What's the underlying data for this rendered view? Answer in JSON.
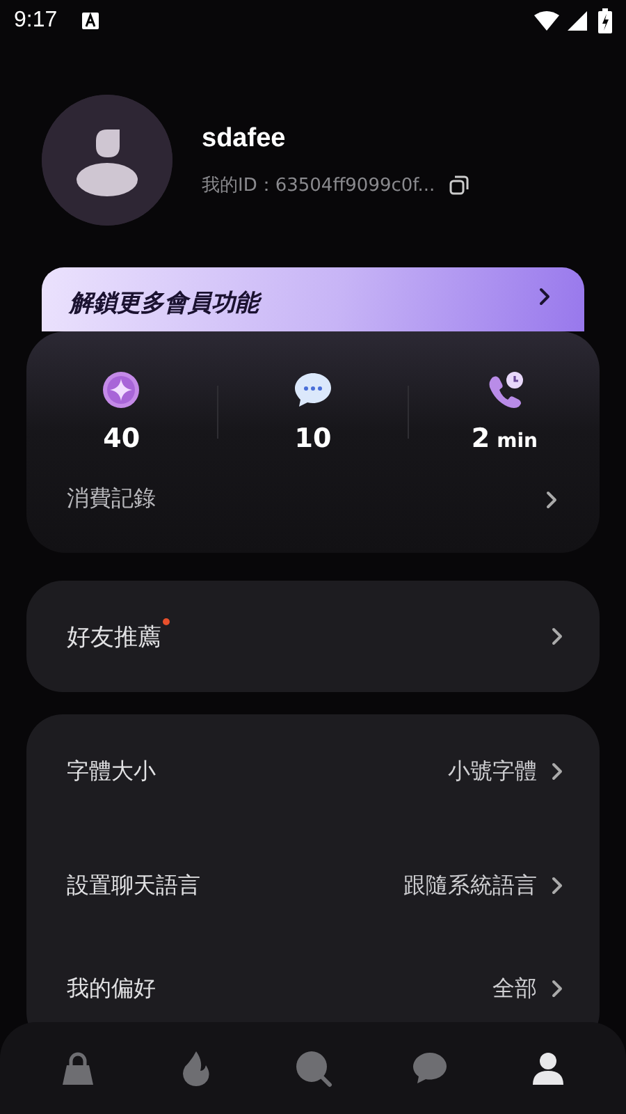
{
  "status_bar": {
    "time": "9:17"
  },
  "profile": {
    "name": "sdafee",
    "id_text": "我的ID：63504ff9099c0f..."
  },
  "vip_banner": {
    "title": "解鎖更多會員功能"
  },
  "stats": [
    {
      "kind": "coin",
      "value": "40"
    },
    {
      "kind": "chat",
      "value": "10"
    },
    {
      "kind": "call",
      "value": "2",
      "unit": "min"
    }
  ],
  "spending": {
    "label": "消費記錄"
  },
  "friends": {
    "label": "好友推薦",
    "new_dot": true
  },
  "settings": [
    {
      "label": "字體大小",
      "value": "小號字體"
    },
    {
      "label": "設置聊天語言",
      "value": "跟隨系統語言"
    },
    {
      "label": "我的偏好",
      "value": "全部"
    }
  ],
  "nav": [
    {
      "kind": "bag",
      "selected": false
    },
    {
      "kind": "flame",
      "selected": false
    },
    {
      "kind": "search",
      "selected": false
    },
    {
      "kind": "chat",
      "selected": false
    },
    {
      "kind": "person",
      "selected": true
    }
  ]
}
